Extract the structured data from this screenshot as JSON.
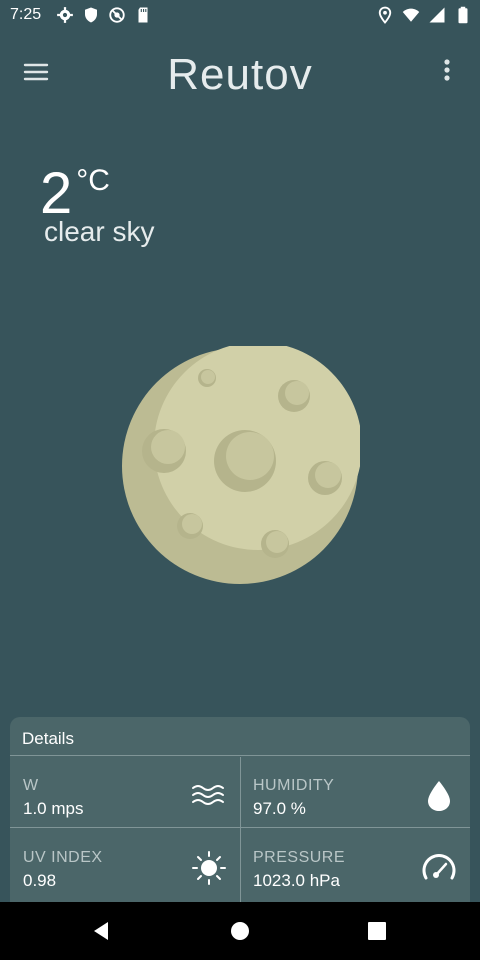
{
  "status_bar": {
    "time": "7:25",
    "left_icons": [
      "gear-icon",
      "shield-icon",
      "no-disturb-icon",
      "sd-card-icon"
    ],
    "right_icons": [
      "location-icon",
      "wifi-icon",
      "signal-icon",
      "battery-icon"
    ]
  },
  "app_bar": {
    "city": "Reutov",
    "menu_icon": "hamburger-menu-icon",
    "more_icon": "more-vertical-icon"
  },
  "current": {
    "temperature": "2",
    "unit": "°C",
    "condition": "clear sky",
    "illustration": "moon-icon"
  },
  "details": {
    "title": "Details",
    "items": [
      {
        "label": "W",
        "value": "1.0 mps",
        "icon": "wind-waves-icon"
      },
      {
        "label": "HUMIDITY",
        "value": "97.0 %",
        "icon": "water-drop-icon"
      },
      {
        "label": "UV INDEX",
        "value": "0.98",
        "icon": "sun-icon"
      },
      {
        "label": "PRESSURE",
        "value": "1023.0 hPa",
        "icon": "gauge-icon"
      }
    ]
  },
  "colors": {
    "background": "#37545b",
    "card": "#4b6669",
    "moon": "#d1d0a7",
    "moon_shadow": "#bbbb92"
  },
  "nav_bar": {
    "buttons": [
      "back-icon",
      "home-icon",
      "recents-icon"
    ]
  }
}
